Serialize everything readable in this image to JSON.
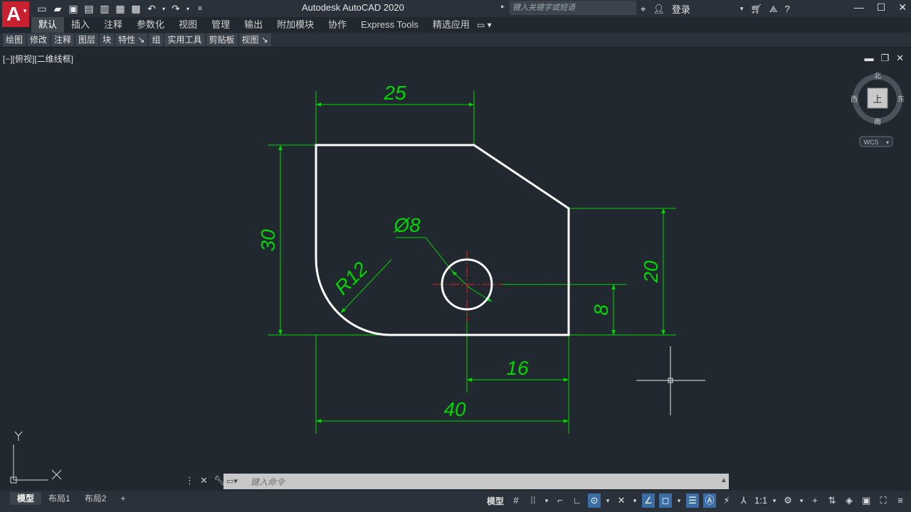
{
  "window": {
    "title": "Autodesk AutoCAD 2020",
    "app_letter": "A",
    "search_placeholder": "键入关键字或短语",
    "login": "登录"
  },
  "ribbon_tabs": [
    "默认",
    "插入",
    "注释",
    "参数化",
    "视图",
    "管理",
    "输出",
    "附加模块",
    "协作",
    "Express Tools",
    "精选应用"
  ],
  "active_tab": "默认",
  "ribbon_panels": [
    "绘图",
    "修改",
    "注释",
    "图层",
    "块",
    "特性 ↘",
    "组",
    "实用工具",
    "剪贴板",
    "视图 ↘"
  ],
  "viewport": {
    "label": "[−][俯视][二维线框]"
  },
  "viewcube": {
    "north": "北",
    "south": "南",
    "east": "东",
    "west": "西",
    "top_face": "上",
    "wcs": "WCS"
  },
  "ucs": {
    "x_label": "X",
    "y_label": "Y"
  },
  "dimensions": {
    "top_width": "25",
    "left_height": "30",
    "right_height": "20",
    "hole_height": "8",
    "hole_offset": "16",
    "total_width": "40",
    "radius": "R12",
    "diameter": "Ø8"
  },
  "command_line": {
    "placeholder": "键入命令"
  },
  "layout_tabs": [
    "模型",
    "布局1",
    "布局2",
    "+"
  ],
  "active_layout": "模型",
  "status": {
    "model": "模型",
    "scale": "1:1"
  },
  "colors": {
    "background": "#212830",
    "dimension": "#00d600",
    "geometry": "#ffffff",
    "centerline": "#e02020"
  }
}
